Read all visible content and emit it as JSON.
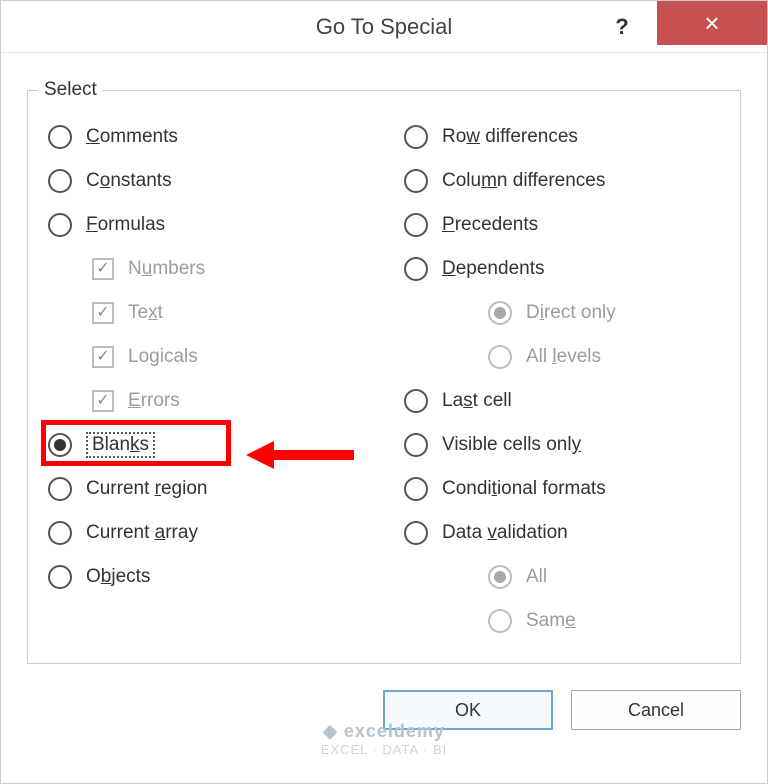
{
  "title": "Go To Special",
  "help_symbol": "?",
  "close_symbol": "×",
  "legend": "Select",
  "left": {
    "comments": {
      "pre": "",
      "u": "C",
      "post": "omments"
    },
    "constants": {
      "pre": "C",
      "u": "o",
      "post": "nstants"
    },
    "formulas": {
      "pre": "",
      "u": "F",
      "post": "ormulas"
    },
    "numbers": {
      "pre": "N",
      "u": "u",
      "post": "mbers"
    },
    "text": {
      "pre": "Te",
      "u": "x",
      "post": "t"
    },
    "logicals": {
      "pre": "Lo",
      "u": "g",
      "post": "icals"
    },
    "errors": {
      "pre": "",
      "u": "E",
      "post": "rrors"
    },
    "blanks": {
      "pre": "Blan",
      "u": "k",
      "post": "s"
    },
    "cregion": {
      "pre": "Current ",
      "u": "r",
      "post": "egion"
    },
    "carray": {
      "pre": "Current ",
      "u": "a",
      "post": "rray"
    },
    "objects": {
      "pre": "O",
      "u": "b",
      "post": "jects"
    }
  },
  "right": {
    "rowdiff": {
      "pre": "Ro",
      "u": "w",
      "post": " differences"
    },
    "coldiff": {
      "pre": "Colu",
      "u": "m",
      "post": "n differences"
    },
    "precedents": {
      "pre": "",
      "u": "P",
      "post": "recedents"
    },
    "dependents": {
      "pre": "",
      "u": "D",
      "post": "ependents"
    },
    "direct": {
      "pre": "D",
      "u": "i",
      "post": "rect only"
    },
    "alllevels": {
      "pre": "All ",
      "u": "l",
      "post": "evels"
    },
    "lastcell": {
      "pre": "La",
      "u": "s",
      "post": "t cell"
    },
    "visible": {
      "pre": "Visible cells onl",
      "u": "y",
      "post": ""
    },
    "condfmt": {
      "pre": "Condi",
      "u": "t",
      "post": "ional formats"
    },
    "datav": {
      "pre": "Data ",
      "u": "v",
      "post": "alidation"
    },
    "all": {
      "pre": "All",
      "u": "",
      "post": ""
    },
    "same": {
      "pre": "Sam",
      "u": "e",
      "post": ""
    }
  },
  "buttons": {
    "ok": "OK",
    "cancel": "Cancel"
  },
  "watermark": {
    "brand": "exceldemy",
    "tag": "EXCEL · DATA · BI"
  }
}
